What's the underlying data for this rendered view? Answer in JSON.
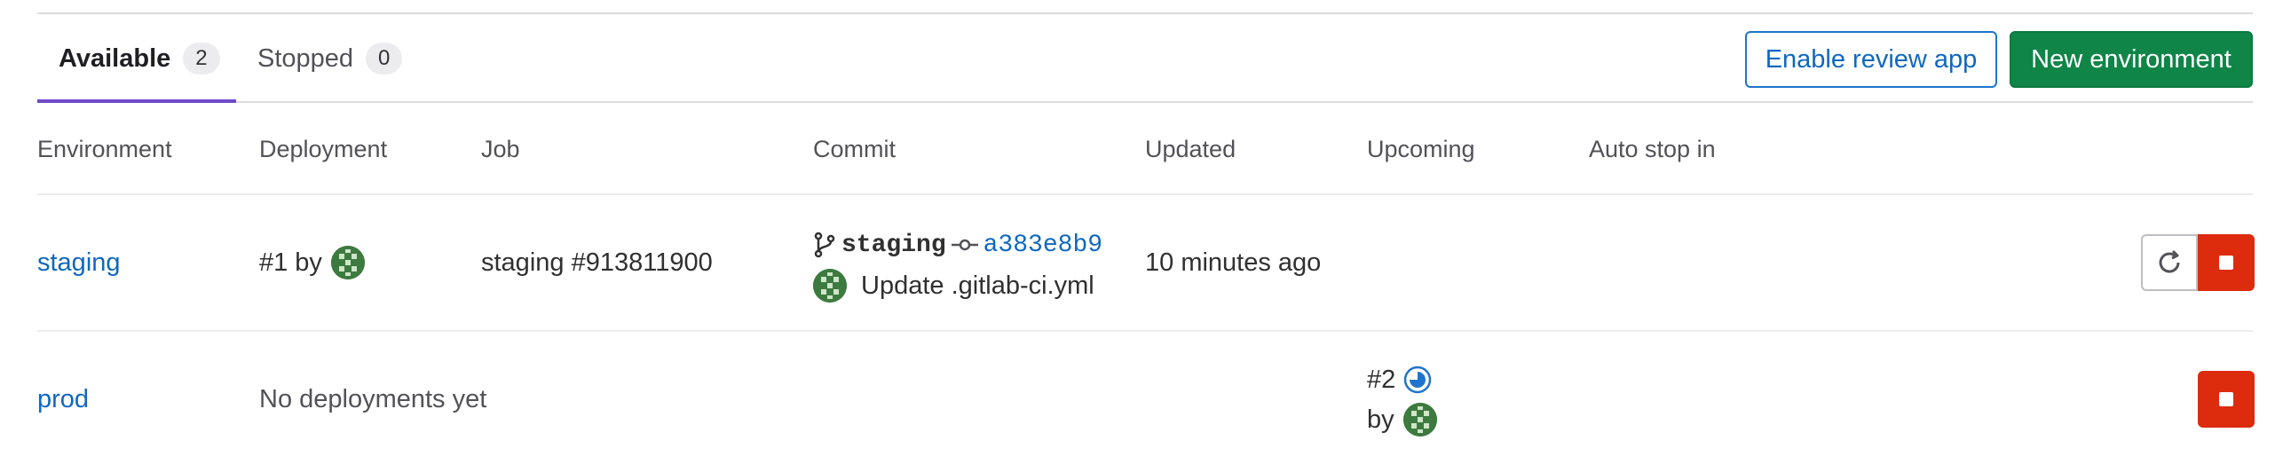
{
  "tabs": [
    {
      "label": "Available",
      "count": "2"
    },
    {
      "label": "Stopped",
      "count": "0"
    }
  ],
  "actions": {
    "enable_review_app": "Enable review app",
    "new_environment": "New environment"
  },
  "table": {
    "headers": [
      "Environment",
      "Deployment",
      "Job",
      "Commit",
      "Updated",
      "Upcoming",
      "Auto stop in"
    ],
    "rows": [
      {
        "environment": "staging",
        "deployment_id": "#1",
        "deployment_by": "by",
        "job": "staging #913811900",
        "commit_ref": "staging",
        "commit_sha": "a383e8b9",
        "commit_title": "Update .gitlab-ci.yml",
        "updated": "10 minutes ago"
      },
      {
        "environment": "prod",
        "deployment_text": "No deployments yet",
        "upcoming_id": "#2",
        "upcoming_by": "by"
      }
    ]
  },
  "icons": {
    "branch": "branch-icon",
    "commit": "commit-icon",
    "redeploy": "retry-icon",
    "stop": "stop-icon",
    "status": "status-running-icon"
  },
  "colors": {
    "link": "#1068bf",
    "primary": "#108548",
    "danger": "#dd2b0e",
    "tab_active": "#6e49cb"
  }
}
